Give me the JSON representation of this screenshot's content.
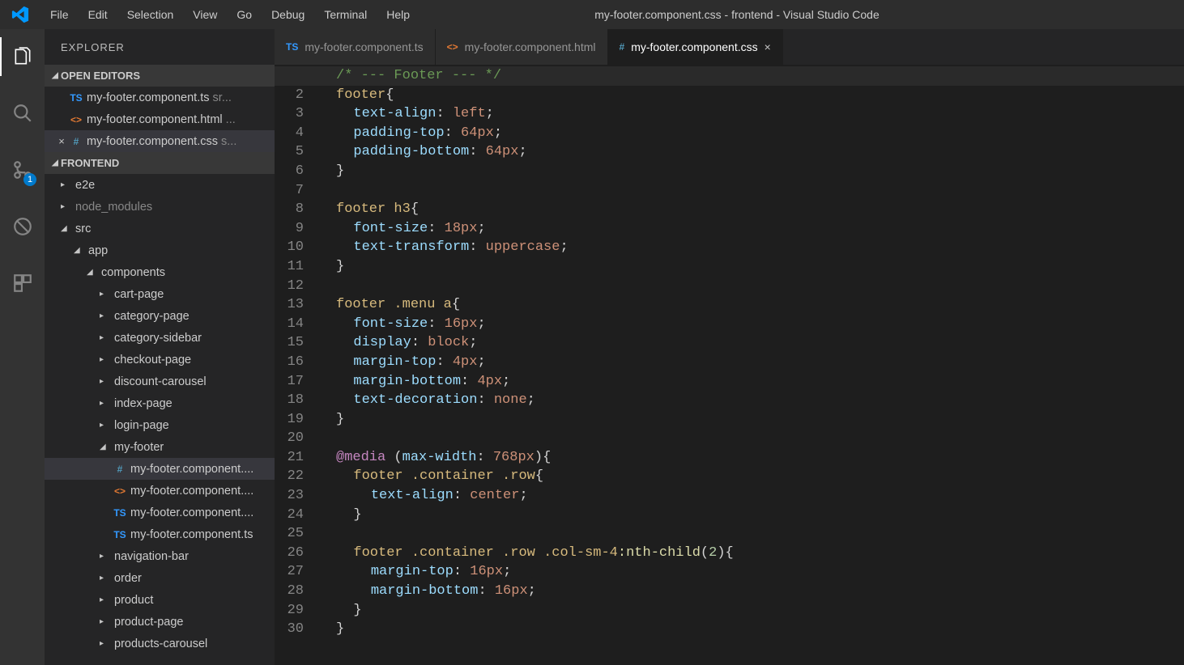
{
  "window": {
    "title": "my-footer.component.css - frontend - Visual Studio Code"
  },
  "menu": {
    "items": [
      "File",
      "Edit",
      "Selection",
      "View",
      "Go",
      "Debug",
      "Terminal",
      "Help"
    ]
  },
  "activitybar": {
    "scm_badge": "1"
  },
  "sidebar": {
    "title": "EXPLORER",
    "sections": {
      "open_editors": {
        "label": "OPEN EDITORS",
        "items": [
          {
            "icon": "TS",
            "iconClass": "ic-ts",
            "name": "my-footer.component.ts",
            "suffix": " sr...",
            "close": ""
          },
          {
            "icon": "<>",
            "iconClass": "ic-html",
            "name": "my-footer.component.html",
            "suffix": " ...",
            "close": ""
          },
          {
            "icon": "#",
            "iconClass": "ic-css",
            "name": "my-footer.component.css",
            "suffix": " s...",
            "close": "×",
            "selected": true
          }
        ]
      },
      "workspace": {
        "label": "FRONTEND",
        "tree": [
          {
            "depth": 0,
            "kind": "folder",
            "open": false,
            "name": "e2e"
          },
          {
            "depth": 0,
            "kind": "folder",
            "open": false,
            "name": "node_modules",
            "dim": true
          },
          {
            "depth": 0,
            "kind": "folder",
            "open": true,
            "name": "src"
          },
          {
            "depth": 1,
            "kind": "folder",
            "open": true,
            "name": "app"
          },
          {
            "depth": 2,
            "kind": "folder",
            "open": true,
            "name": "components"
          },
          {
            "depth": 3,
            "kind": "folder",
            "open": false,
            "name": "cart-page"
          },
          {
            "depth": 3,
            "kind": "folder",
            "open": false,
            "name": "category-page"
          },
          {
            "depth": 3,
            "kind": "folder",
            "open": false,
            "name": "category-sidebar"
          },
          {
            "depth": 3,
            "kind": "folder",
            "open": false,
            "name": "checkout-page"
          },
          {
            "depth": 3,
            "kind": "folder",
            "open": false,
            "name": "discount-carousel"
          },
          {
            "depth": 3,
            "kind": "folder",
            "open": false,
            "name": "index-page"
          },
          {
            "depth": 3,
            "kind": "folder",
            "open": false,
            "name": "login-page"
          },
          {
            "depth": 3,
            "kind": "folder",
            "open": true,
            "name": "my-footer"
          },
          {
            "depth": 4,
            "kind": "file",
            "icon": "#",
            "iconClass": "ic-css",
            "name": "my-footer.component....",
            "selected": true
          },
          {
            "depth": 4,
            "kind": "file",
            "icon": "<>",
            "iconClass": "ic-html",
            "name": "my-footer.component...."
          },
          {
            "depth": 4,
            "kind": "file",
            "icon": "TS",
            "iconClass": "ic-ts",
            "name": "my-footer.component...."
          },
          {
            "depth": 4,
            "kind": "file",
            "icon": "TS",
            "iconClass": "ic-ts",
            "name": "my-footer.component.ts"
          },
          {
            "depth": 3,
            "kind": "folder",
            "open": false,
            "name": "navigation-bar"
          },
          {
            "depth": 3,
            "kind": "folder",
            "open": false,
            "name": "order"
          },
          {
            "depth": 3,
            "kind": "folder",
            "open": false,
            "name": "product"
          },
          {
            "depth": 3,
            "kind": "folder",
            "open": false,
            "name": "product-page"
          },
          {
            "depth": 3,
            "kind": "folder",
            "open": false,
            "name": "products-carousel"
          }
        ]
      }
    }
  },
  "tabs": [
    {
      "icon": "TS",
      "iconClass": "ic-ts",
      "label": "my-footer.component.ts",
      "active": false
    },
    {
      "icon": "<>",
      "iconClass": "ic-html",
      "label": "my-footer.component.html",
      "active": false
    },
    {
      "icon": "#",
      "iconClass": "ic-css",
      "label": "my-footer.component.css",
      "active": true,
      "close": "×"
    }
  ],
  "editor": {
    "highlight_line": 1,
    "lines": [
      [
        {
          "c": "comment",
          "t": "/* --- Footer --- */"
        }
      ],
      [
        {
          "c": "selector",
          "t": "footer"
        },
        {
          "c": "brace",
          "t": "{"
        }
      ],
      [
        {
          "indent": 1
        },
        {
          "c": "prop",
          "t": "text-align"
        },
        {
          "c": "punc",
          "t": ": "
        },
        {
          "c": "value",
          "t": "left"
        },
        {
          "c": "punc",
          "t": ";"
        }
      ],
      [
        {
          "indent": 1
        },
        {
          "c": "prop",
          "t": "padding-top"
        },
        {
          "c": "punc",
          "t": ": "
        },
        {
          "c": "value",
          "t": "64px"
        },
        {
          "c": "punc",
          "t": ";"
        }
      ],
      [
        {
          "indent": 1
        },
        {
          "c": "prop",
          "t": "padding-bottom"
        },
        {
          "c": "punc",
          "t": ": "
        },
        {
          "c": "value",
          "t": "64px"
        },
        {
          "c": "punc",
          "t": ";"
        }
      ],
      [
        {
          "c": "brace",
          "t": "}"
        }
      ],
      [],
      [
        {
          "c": "selector",
          "t": "footer h3"
        },
        {
          "c": "brace",
          "t": "{"
        }
      ],
      [
        {
          "indent": 1
        },
        {
          "c": "prop",
          "t": "font-size"
        },
        {
          "c": "punc",
          "t": ": "
        },
        {
          "c": "value",
          "t": "18px"
        },
        {
          "c": "punc",
          "t": ";"
        }
      ],
      [
        {
          "indent": 1
        },
        {
          "c": "prop",
          "t": "text-transform"
        },
        {
          "c": "punc",
          "t": ": "
        },
        {
          "c": "value",
          "t": "uppercase"
        },
        {
          "c": "punc",
          "t": ";"
        }
      ],
      [
        {
          "c": "brace",
          "t": "}"
        }
      ],
      [],
      [
        {
          "c": "selector",
          "t": "footer "
        },
        {
          "c": "selector",
          "t": ".menu a"
        },
        {
          "c": "brace",
          "t": "{"
        }
      ],
      [
        {
          "indent": 1
        },
        {
          "c": "prop",
          "t": "font-size"
        },
        {
          "c": "punc",
          "t": ": "
        },
        {
          "c": "value",
          "t": "16px"
        },
        {
          "c": "punc",
          "t": ";"
        }
      ],
      [
        {
          "indent": 1
        },
        {
          "c": "prop",
          "t": "display"
        },
        {
          "c": "punc",
          "t": ": "
        },
        {
          "c": "value",
          "t": "block"
        },
        {
          "c": "punc",
          "t": ";"
        }
      ],
      [
        {
          "indent": 1
        },
        {
          "c": "prop",
          "t": "margin-top"
        },
        {
          "c": "punc",
          "t": ": "
        },
        {
          "c": "value",
          "t": "4px"
        },
        {
          "c": "punc",
          "t": ";"
        }
      ],
      [
        {
          "indent": 1
        },
        {
          "c": "prop",
          "t": "margin-bottom"
        },
        {
          "c": "punc",
          "t": ": "
        },
        {
          "c": "value",
          "t": "4px"
        },
        {
          "c": "punc",
          "t": ";"
        }
      ],
      [
        {
          "indent": 1
        },
        {
          "c": "prop",
          "t": "text-decoration"
        },
        {
          "c": "punc",
          "t": ": "
        },
        {
          "c": "value",
          "t": "none"
        },
        {
          "c": "punc",
          "t": ";"
        }
      ],
      [
        {
          "c": "brace",
          "t": "}"
        }
      ],
      [],
      [
        {
          "c": "keyword",
          "t": "@media"
        },
        {
          "c": "brace",
          "t": " ("
        },
        {
          "c": "prop",
          "t": "max-width"
        },
        {
          "c": "punc",
          "t": ": "
        },
        {
          "c": "value",
          "t": "768px"
        },
        {
          "c": "brace",
          "t": "){"
        }
      ],
      [
        {
          "indent": 1
        },
        {
          "c": "selector",
          "t": "footer "
        },
        {
          "c": "selector",
          "t": ".container "
        },
        {
          "c": "selector",
          "t": ".row"
        },
        {
          "c": "brace",
          "t": "{"
        }
      ],
      [
        {
          "indent": 2
        },
        {
          "c": "prop",
          "t": "text-align"
        },
        {
          "c": "punc",
          "t": ": "
        },
        {
          "c": "value",
          "t": "center"
        },
        {
          "c": "punc",
          "t": ";"
        }
      ],
      [
        {
          "indent": 1
        },
        {
          "c": "brace",
          "t": "}"
        }
      ],
      [],
      [
        {
          "indent": 1
        },
        {
          "c": "selector",
          "t": "footer "
        },
        {
          "c": "selector",
          "t": ".container "
        },
        {
          "c": "selector",
          "t": ".row "
        },
        {
          "c": "selector",
          "t": ".col-sm-4"
        },
        {
          "c": "func",
          "t": ":nth-child"
        },
        {
          "c": "brace",
          "t": "("
        },
        {
          "c": "number",
          "t": "2"
        },
        {
          "c": "brace",
          "t": "){"
        }
      ],
      [
        {
          "indent": 2
        },
        {
          "c": "prop",
          "t": "margin-top"
        },
        {
          "c": "punc",
          "t": ": "
        },
        {
          "c": "value",
          "t": "16px"
        },
        {
          "c": "punc",
          "t": ";"
        }
      ],
      [
        {
          "indent": 2
        },
        {
          "c": "prop",
          "t": "margin-bottom"
        },
        {
          "c": "punc",
          "t": ": "
        },
        {
          "c": "value",
          "t": "16px"
        },
        {
          "c": "punc",
          "t": ";"
        }
      ],
      [
        {
          "indent": 1
        },
        {
          "c": "brace",
          "t": "}"
        }
      ],
      [
        {
          "c": "brace",
          "t": "}"
        }
      ]
    ]
  }
}
